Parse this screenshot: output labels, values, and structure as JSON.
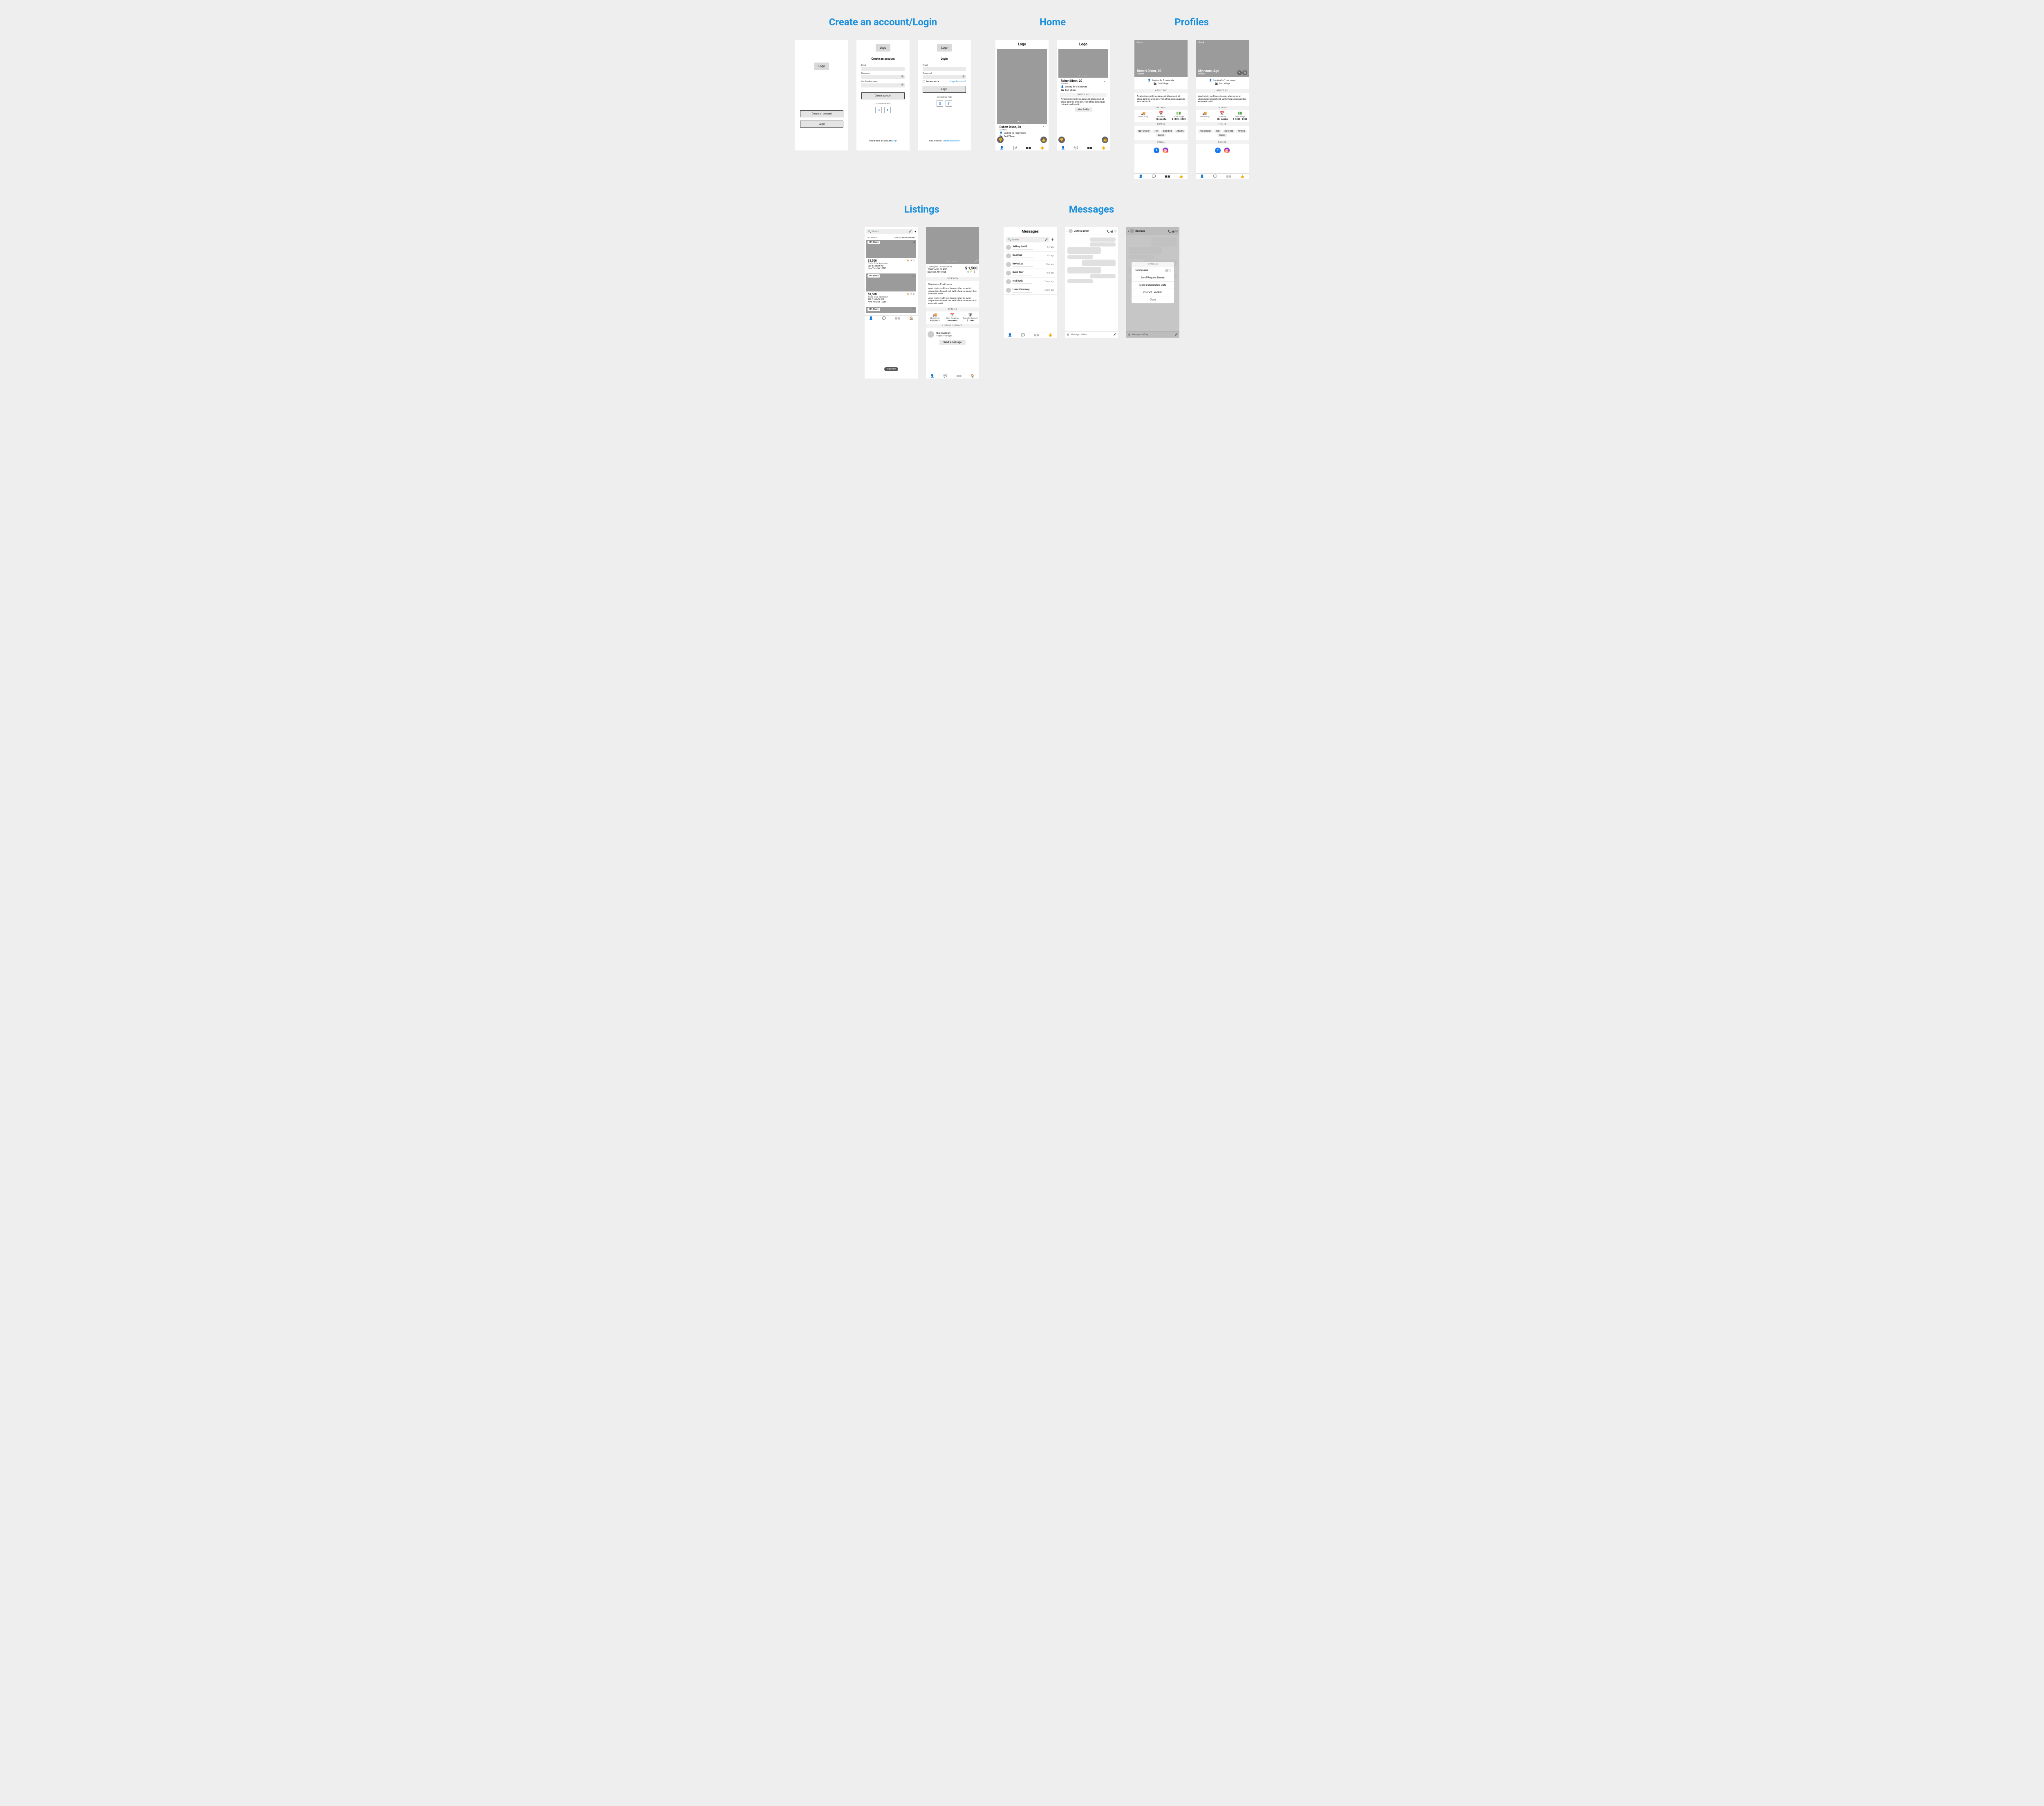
{
  "sections": {
    "auth_title": "Create an account/Login",
    "home_title": "Home",
    "profiles_title": "Profiles",
    "listings_title": "Listings",
    "messages_title": "Messages"
  },
  "common": {
    "logo": "Logo"
  },
  "auth": {
    "landing": {
      "create": "Create an account",
      "login": "Login"
    },
    "create": {
      "heading": "Create an account",
      "email": "Email",
      "password": "Password",
      "confirm": "Confirm Password",
      "submit": "Create account",
      "or": "or continue with",
      "footer1": "Already have an account?",
      "footer2": "Login"
    },
    "login": {
      "heading": "Login",
      "email": "Email",
      "password": "Password",
      "remember": "Remember me",
      "forgot": "Forget Password?",
      "submit": "Login",
      "or": "or continue with",
      "footer1": "New to Room?",
      "footer2": "Create an account"
    }
  },
  "home": {
    "card": {
      "name": "Robert Dixon, 20",
      "role": "Student",
      "l1": "Looking for 1 roommate",
      "l2": "East Village",
      "aboutHead": "ABOUT ME",
      "about": "Amet minim mollit non deserunt ullamco est sit aliqua dolor do amet sint. Velit officia consequat duis enim velit mollit.",
      "view": "View Profile"
    }
  },
  "profile": {
    "back": "Back",
    "name1": "Robert Dixon, 20",
    "name2": "My name, Age",
    "role": "Student",
    "l1": "Looking for 1 roommate",
    "l2": "East Village",
    "aboutHead": "ABOUT ME",
    "about": "Amet minim mollit non deserunt ullamco est sit aliqua dolor do amet sint. Velit officia consequat duis enim velit mollit.",
    "detailsHead": "DETAILS",
    "d1_l": "Move in by",
    "d1_v": "---",
    "d2_l": "Duration",
    "d2_v": "10+ months",
    "d3_l": "Price range",
    "d3_v": "$ 1,500 - 2,000",
    "traitsHead": "TRAITS",
    "traits": [
      "Non-smoker",
      "Tidy",
      "Early Bird",
      "Athletic",
      "Gamer"
    ],
    "socialHead": "SOCIAL"
  },
  "listings": {
    "search_ph": "Search",
    "results": "103 results",
    "sortPrefix": "Sort by:",
    "sortValue": "Recommended",
    "match": "94% Match",
    "price": "$1,500",
    "meta1": "3 bds, 2 ba, Apartment",
    "addr1": "200 E 66th St #5F",
    "addr2": "New York, NY 10065",
    "mapview": "Map View",
    "detail": {
      "lookfor": "Looking for 1 roommate at",
      "overviewHead": "OVERVIEW",
      "bedbath": "3 bedrooms, 2 bathrooms",
      "para": "Amet minim mollit non deserunt ullamco est sit aliqua dolor do amet sint. Velit officia consequat duis enim velit mollit.",
      "detailsHead": "DETAILS",
      "d1_l": "Move in by",
      "d1_v": "12/1/2021",
      "d2_l": "Min. Duration",
      "d2_v": "6+ months",
      "d3_l": "Security Deposit",
      "d3_v": "$ 1,500",
      "contactHead": "LISTING CONTACT",
      "contact_name": "Mia Gonzalez",
      "contact_role": "Property manager",
      "send": "Send a message"
    }
  },
  "messages": {
    "title": "Messages",
    "search_ph": "Search",
    "items": [
      {
        "name": "Jeffrey Smith",
        "time": "1 hr ago"
      },
      {
        "name": "Roomies",
        "time": "1 hr ago"
      },
      {
        "name": "Kevin Lee",
        "time": "4 hrs ago"
      },
      {
        "name": "Rohit Nair",
        "time": "1 day ago"
      },
      {
        "name": "Neil Rathi",
        "time": "2 days ago"
      },
      {
        "name": "Louis Carroway",
        "time": "2 days ago"
      }
    ],
    "chat": {
      "peer1": "Jeffrey Smith",
      "peer2": "Roomies",
      "input_ph": "Message..Jeffrey"
    },
    "modal": {
      "head": "OPTIONS",
      "toggle": "Roommates",
      "i1": "Send/Request Money",
      "i2": "Make Collaborative Lists",
      "i3": "Contact Landlord",
      "close": "Close"
    }
  }
}
